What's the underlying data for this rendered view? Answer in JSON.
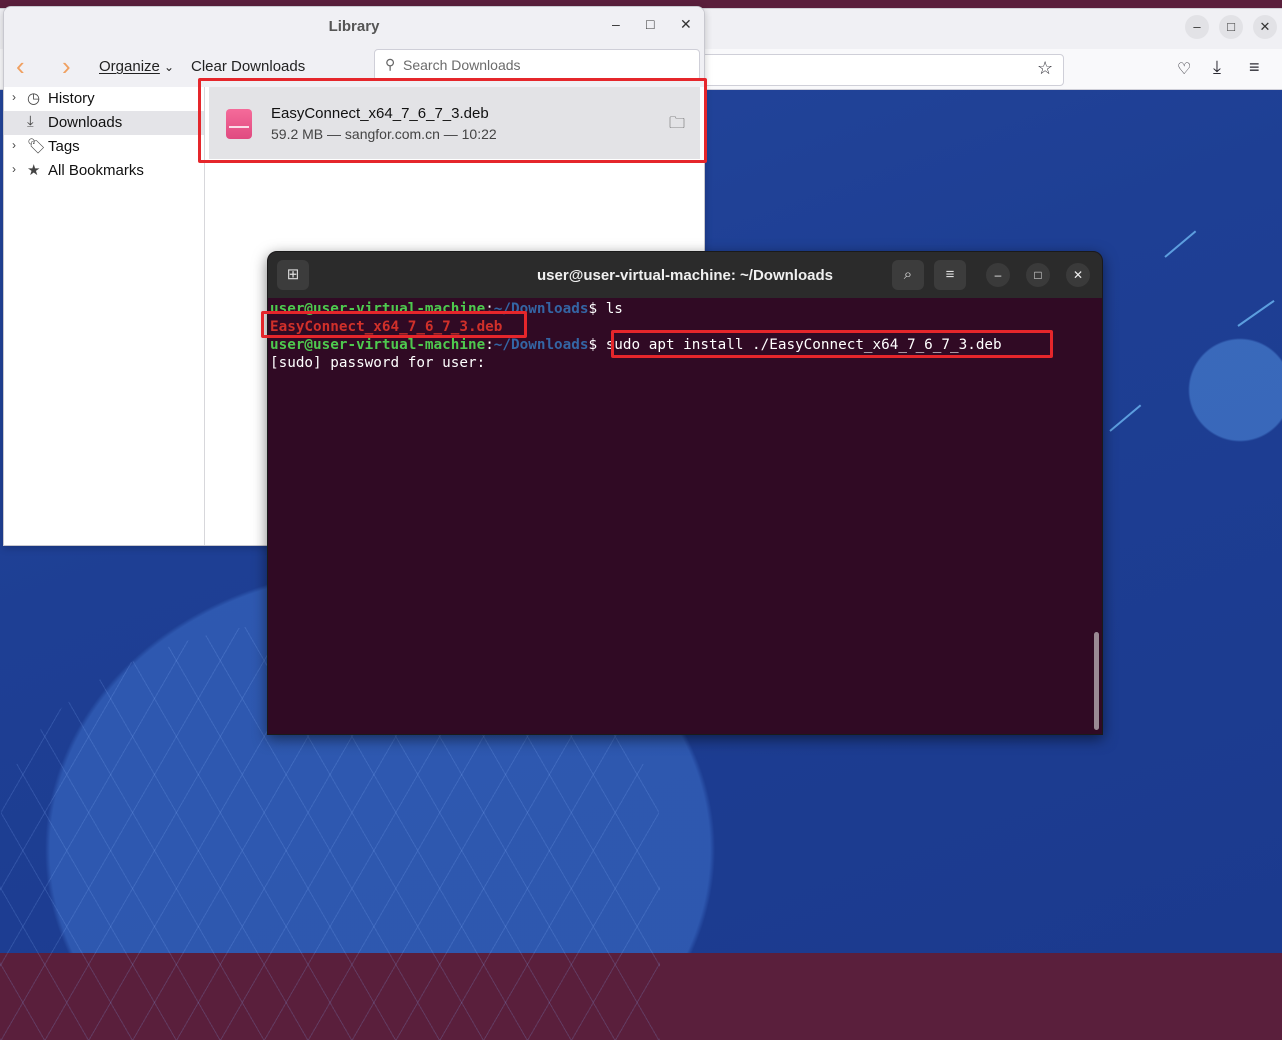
{
  "browser": {
    "window_controls": [
      "–",
      "□",
      "✕"
    ]
  },
  "library": {
    "title": "Library",
    "controls": [
      "–",
      "□",
      "✕"
    ],
    "toolbar": {
      "back_icon": "‹",
      "forward_icon": "›",
      "organize_label": "Organize",
      "organize_chevron": "⌄",
      "clear_downloads_label": "Clear Downloads",
      "search_placeholder": "Search Downloads"
    },
    "sidebar": [
      {
        "label": "History",
        "icon": "clock-icon",
        "twisty": true,
        "selected": false
      },
      {
        "label": "Downloads",
        "icon": "download-icon",
        "twisty": false,
        "selected": true
      },
      {
        "label": "Tags",
        "icon": "tag-icon",
        "twisty": true,
        "selected": false
      },
      {
        "label": "All Bookmarks",
        "icon": "star-icon",
        "twisty": true,
        "selected": false
      }
    ],
    "downloads": [
      {
        "filename": "EasyConnect_x64_7_6_7_3.deb",
        "meta": "59.2 MB — sangfor.com.cn — 10:22"
      }
    ]
  },
  "terminal": {
    "title": "user@user-virtual-machine: ~/Downloads",
    "prompt_user": "user@user-virtual-machine",
    "prompt_sep": ":",
    "prompt_path": "~/Downloads",
    "prompt_symbol": "$ ",
    "cmd1": "ls",
    "output1": "EasyConnect_x64_7_6_7_3.deb",
    "cmd2": "sudo apt install ./EasyConnect_x64_7_6_7_3.deb",
    "output2": "[sudo] password for user: "
  },
  "colors": {
    "highlight": "#e5262b",
    "terminal_bg": "#300a24",
    "prompt_user": "#4ec94e",
    "prompt_path": "#3465a4",
    "deb_file": "#d0302a"
  }
}
